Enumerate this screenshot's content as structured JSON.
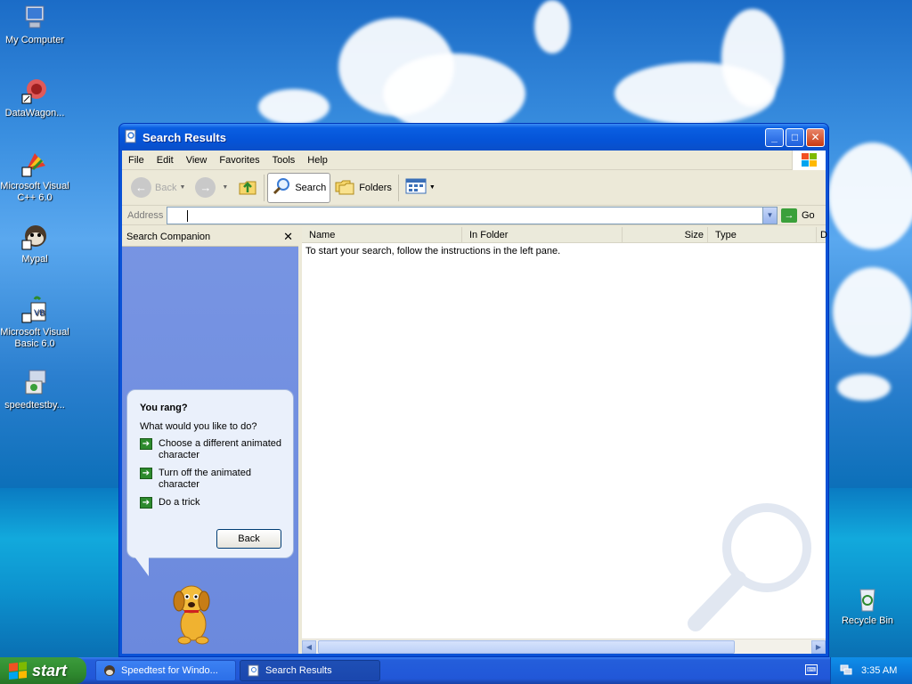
{
  "desktop": {
    "icons": [
      {
        "label": "My Computer"
      },
      {
        "label": "DataWagon..."
      },
      {
        "label": "Microsoft Visual C++ 6.0"
      },
      {
        "label": "Mypal"
      },
      {
        "label": "Microsoft Visual Basic 6.0"
      },
      {
        "label": "speedtestby..."
      },
      {
        "label": "Recycle Bin"
      }
    ]
  },
  "window": {
    "title": "Search Results",
    "menu": [
      "File",
      "Edit",
      "View",
      "Favorites",
      "Tools",
      "Help"
    ],
    "toolbar": {
      "back": "Back",
      "search": "Search",
      "folders": "Folders"
    },
    "address": {
      "label": "Address",
      "value": "",
      "go": "Go"
    },
    "companion": {
      "title": "Search Companion",
      "bubble": {
        "heading": "You rang?",
        "question": "What would you like to do?",
        "options": [
          "Choose a different animated character",
          "Turn off the animated character",
          "Do a trick"
        ],
        "back": "Back"
      }
    },
    "results": {
      "columns": [
        "Name",
        "In Folder",
        "Size",
        "Type",
        "D"
      ],
      "message": "To start your search, follow the instructions in the left pane."
    }
  },
  "taskbar": {
    "start": "start",
    "tasks": [
      "Speedtest for Windo...",
      "Search Results"
    ],
    "clock": "3:35 AM"
  }
}
